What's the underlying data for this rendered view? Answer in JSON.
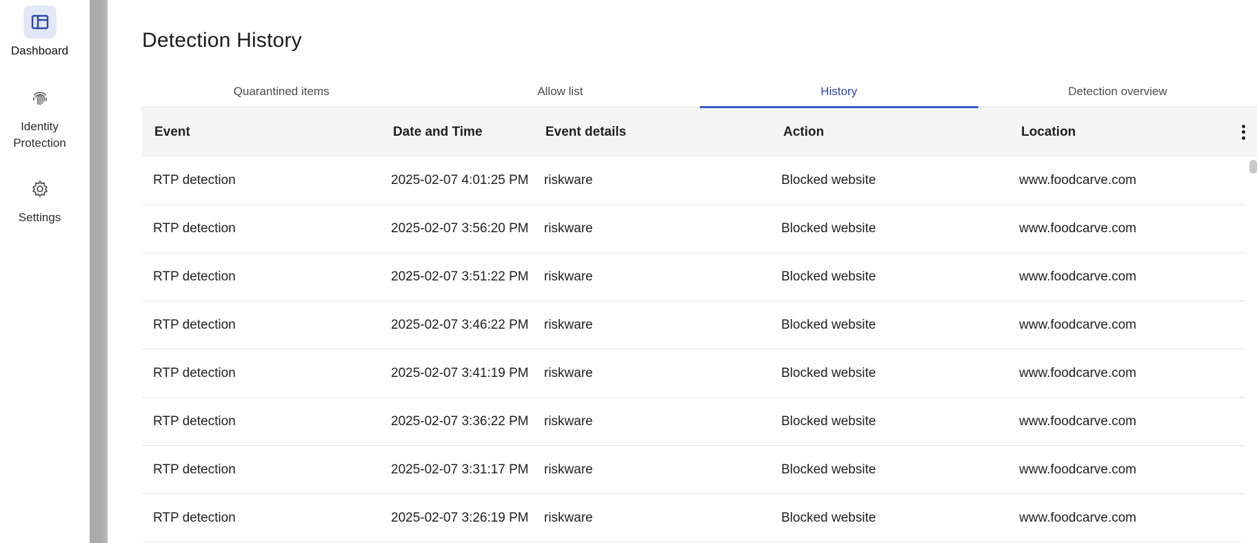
{
  "nav": {
    "items": [
      {
        "label": "Dashboard",
        "icon": "dashboard-icon",
        "active": true
      },
      {
        "label": "Identity\nProtection",
        "icon": "fingerprint-icon",
        "active": false
      },
      {
        "label": "Settings",
        "icon": "gear-icon",
        "active": false
      }
    ]
  },
  "page": {
    "title": "Detection History"
  },
  "tabs": [
    {
      "label": "Quarantined items",
      "active": false
    },
    {
      "label": "Allow list",
      "active": false
    },
    {
      "label": "History",
      "active": true
    },
    {
      "label": "Detection overview",
      "active": false
    }
  ],
  "table": {
    "headers": [
      "Event",
      "Date and Time",
      "Event details",
      "Action",
      "Location"
    ],
    "rows": [
      [
        "RTP detection",
        "2025-02-07 4:01:25 PM",
        "riskware",
        "Blocked website",
        "www.foodcarve.com"
      ],
      [
        "RTP detection",
        "2025-02-07 3:56:20 PM",
        "riskware",
        "Blocked website",
        "www.foodcarve.com"
      ],
      [
        "RTP detection",
        "2025-02-07 3:51:22 PM",
        "riskware",
        "Blocked website",
        "www.foodcarve.com"
      ],
      [
        "RTP detection",
        "2025-02-07 3:46:22 PM",
        "riskware",
        "Blocked website",
        "www.foodcarve.com"
      ],
      [
        "RTP detection",
        "2025-02-07 3:41:19 PM",
        "riskware",
        "Blocked website",
        "www.foodcarve.com"
      ],
      [
        "RTP detection",
        "2025-02-07 3:36:22 PM",
        "riskware",
        "Blocked website",
        "www.foodcarve.com"
      ],
      [
        "RTP detection",
        "2025-02-07 3:31:17 PM",
        "riskware",
        "Blocked website",
        "www.foodcarve.com"
      ],
      [
        "RTP detection",
        "2025-02-07 3:26:19 PM",
        "riskware",
        "Blocked website",
        "www.foodcarve.com"
      ]
    ]
  },
  "colors": {
    "accent": "#3a5bc7",
    "active_tab_text": "#2a46a8",
    "active_nav_bg": "#e3e8f6"
  }
}
